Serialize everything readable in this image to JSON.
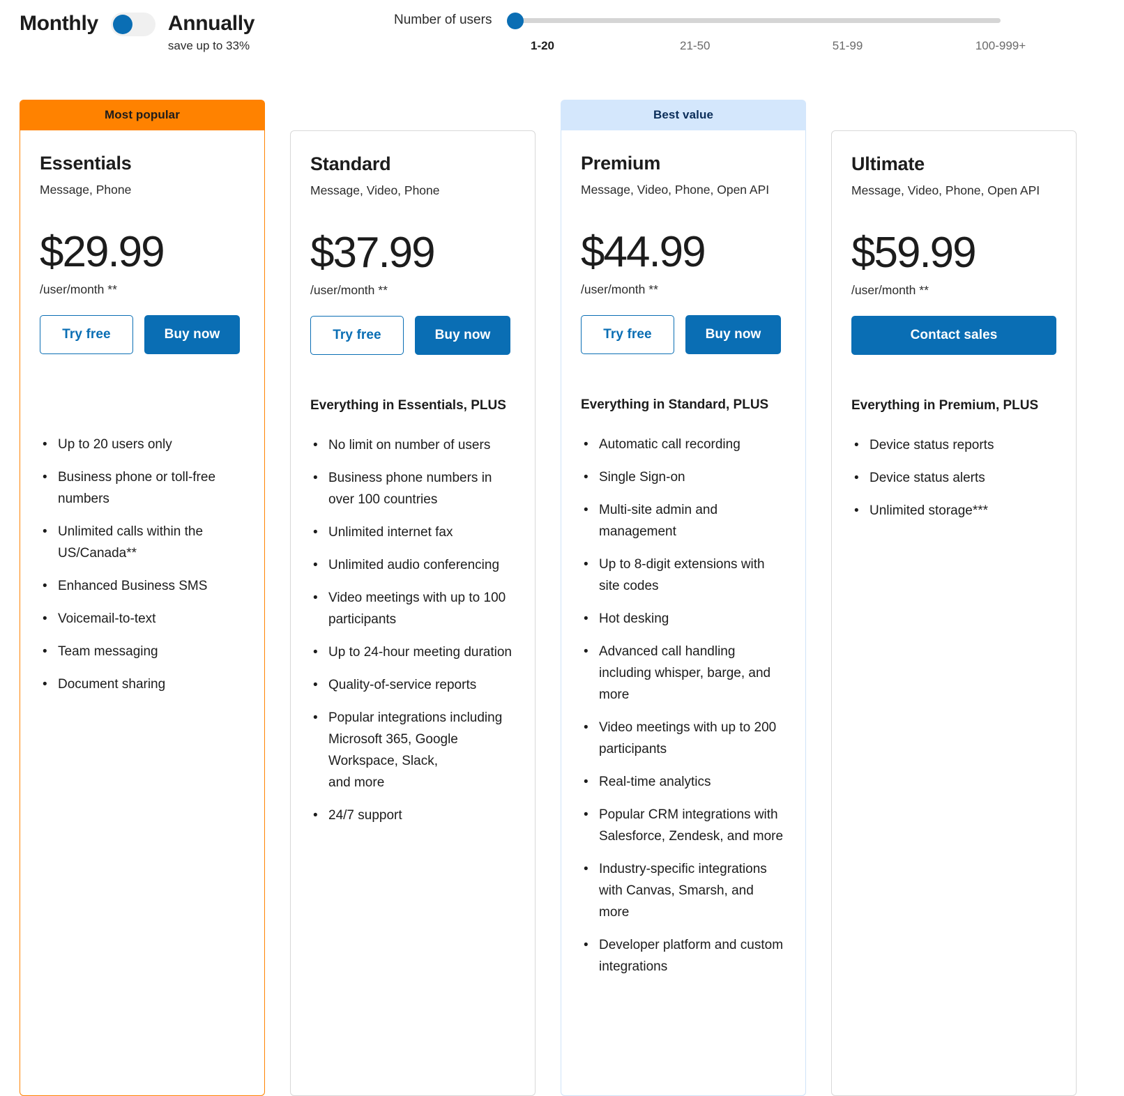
{
  "billing": {
    "monthly_label": "Monthly",
    "annual_label": "Annually",
    "save_note": "save up to 33%",
    "selected": "Monthly"
  },
  "users_slider": {
    "caption": "Number of users",
    "ticks": [
      "1-20",
      "21-50",
      "51-99",
      "100-999+"
    ],
    "selected_index": 0
  },
  "colors": {
    "brand_blue": "#0a6eb4",
    "most_popular_orange": "#ff8200",
    "best_value_blue": "#d4e7fc",
    "card_border_gray": "#d8d8d8"
  },
  "plans": [
    {
      "badge": "Most popular",
      "badge_style": "orange",
      "name": "Essentials",
      "subtitle": "Message, Phone",
      "price": "$29.99",
      "price_unit": "/user/month **",
      "buttons": [
        {
          "label": "Try free",
          "style": "outline"
        },
        {
          "label": "Buy now",
          "style": "solid"
        }
      ],
      "plus_heading": "",
      "features": [
        "Up to 20 users only",
        "Business phone or toll-free numbers",
        "Unlimited calls within the US/Canada**",
        "Enhanced Business SMS",
        "Voicemail-to-text",
        "Team messaging",
        "Document sharing"
      ]
    },
    {
      "badge": "",
      "badge_style": "none",
      "name": "Standard",
      "subtitle": "Message, Video, Phone",
      "price": "$37.99",
      "price_unit": "/user/month **",
      "buttons": [
        {
          "label": "Try free",
          "style": "outline"
        },
        {
          "label": "Buy now",
          "style": "solid"
        }
      ],
      "plus_heading": "Everything in Essentials, PLUS",
      "features": [
        "No limit on number of users",
        "Business phone numbers in over 100 countries",
        "Unlimited internet fax",
        "Unlimited audio conferencing",
        "Video meetings with up to 100 participants",
        "Up to 24-hour meeting duration",
        "Quality-of-service reports",
        "Popular integrations including\nMicrosoft 365, Google Workspace, Slack,\nand more",
        "24/7 support"
      ]
    },
    {
      "badge": "Best value",
      "badge_style": "blue",
      "name": "Premium",
      "subtitle": "Message, Video, Phone, Open API",
      "price": "$44.99",
      "price_unit": "/user/month **",
      "buttons": [
        {
          "label": "Try free",
          "style": "outline"
        },
        {
          "label": "Buy now",
          "style": "solid"
        }
      ],
      "plus_heading": "Everything in Standard, PLUS",
      "features": [
        "Automatic call recording",
        "Single Sign-on",
        "Multi-site admin and management",
        "Up to 8-digit extensions with site codes",
        "Hot desking",
        "Advanced call handling including whisper, barge, and more",
        "Video meetings with up to 200 participants",
        "Real-time analytics",
        "Popular CRM integrations with Salesforce, Zendesk, and more",
        "Industry-specific integrations with Canvas, Smarsh, and more",
        "Developer platform and custom integrations"
      ]
    },
    {
      "badge": "",
      "badge_style": "none",
      "name": "Ultimate",
      "subtitle": "Message, Video, Phone, Open API",
      "price": "$59.99",
      "price_unit": "/user/month **",
      "buttons": [
        {
          "label": "Contact sales",
          "style": "wide"
        }
      ],
      "plus_heading": "Everything in Premium, PLUS",
      "features": [
        "Device status reports",
        "Device status alerts",
        "Unlimited storage***"
      ]
    }
  ]
}
